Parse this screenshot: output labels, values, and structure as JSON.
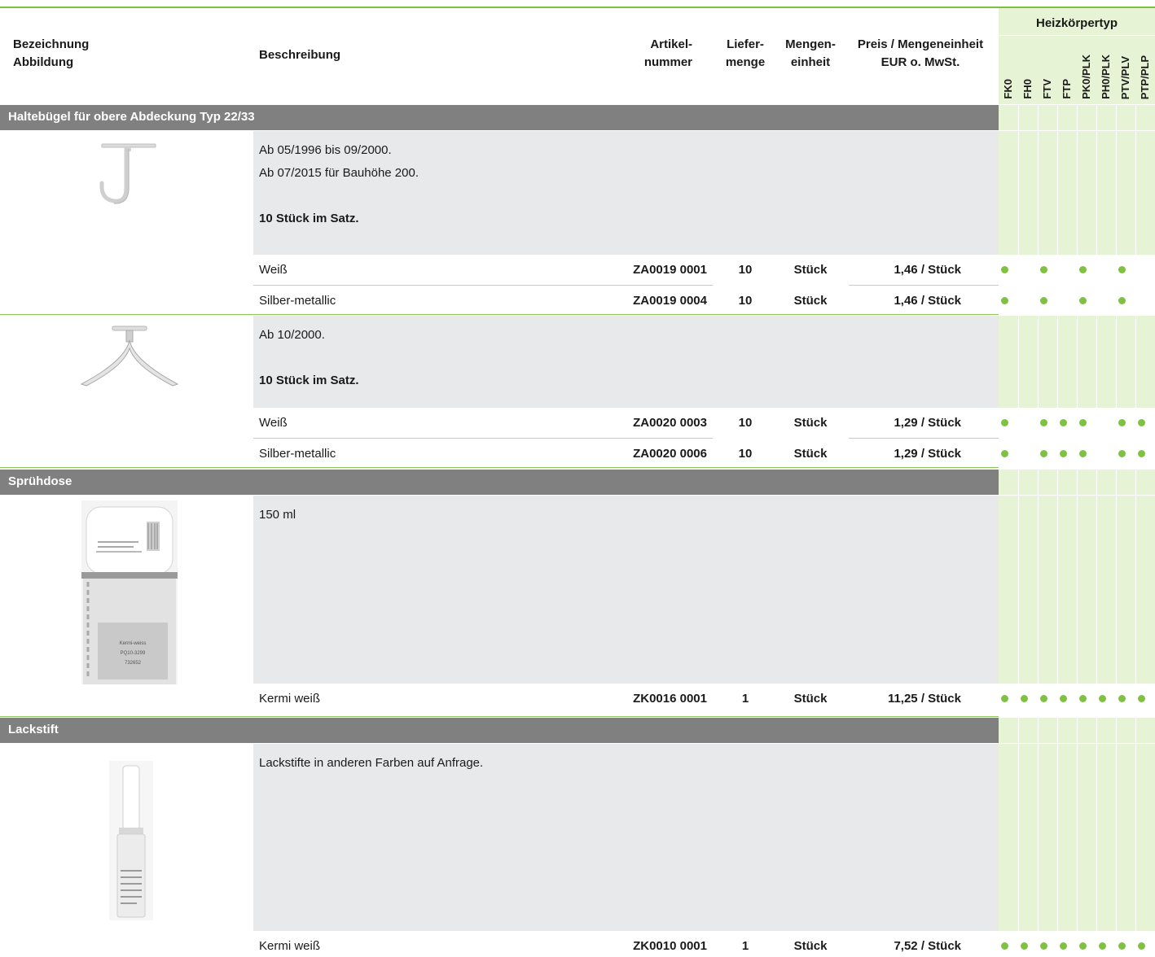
{
  "header": {
    "col1": [
      "Bezeichnung",
      "Abbildung"
    ],
    "col2": "Beschreibung",
    "col3": [
      "Artikel-",
      "nummer"
    ],
    "col4": [
      "Liefer-",
      "menge"
    ],
    "col5": [
      "Mengen-",
      "einheit"
    ],
    "col6": [
      "Preis / Mengeneinheit",
      "EUR o. MwSt."
    ],
    "heiz_title": "Heizkörpertyp",
    "heiz_types": [
      "FK0",
      "FH0",
      "FTV",
      "FTP",
      "PK0/PLK",
      "PH0/PLK",
      "PTV/PLV",
      "PTP/PLP"
    ]
  },
  "sections": [
    {
      "title": "Haltebügel für obere Abdeckung Typ 22/33",
      "groups": [
        {
          "image": "j-hook-bracket",
          "desc_lines": [
            "Ab 05/1996 bis 09/2000.",
            "Ab 07/2015 für Bauhöhe 200."
          ],
          "desc_bold": "10 Stück im Satz.",
          "rows": [
            {
              "label": "Weiß",
              "artikel": "ZA0019 0001",
              "menge": "10",
              "einheit": "Stück",
              "preis": "1,46 / Stück",
              "types": [
                1,
                0,
                1,
                0,
                1,
                0,
                1,
                0
              ]
            },
            {
              "label": "Silber-metallic",
              "artikel": "ZA0019 0004",
              "menge": "10",
              "einheit": "Stück",
              "preis": "1,46 / Stück",
              "types": [
                1,
                0,
                1,
                0,
                1,
                0,
                1,
                0
              ]
            }
          ]
        },
        {
          "image": "y-bracket",
          "desc_lines": [
            "Ab 10/2000."
          ],
          "desc_bold": "10 Stück im Satz.",
          "rows": [
            {
              "label": "Weiß",
              "artikel": "ZA0020 0003",
              "menge": "10",
              "einheit": "Stück",
              "preis": "1,29 / Stück",
              "types": [
                1,
                0,
                1,
                1,
                1,
                0,
                1,
                1
              ]
            },
            {
              "label": "Silber-metallic",
              "artikel": "ZA0020 0006",
              "menge": "10",
              "einheit": "Stück",
              "preis": "1,29 / Stück",
              "types": [
                1,
                0,
                1,
                1,
                1,
                0,
                1,
                1
              ]
            }
          ]
        }
      ]
    },
    {
      "title": "Sprühdose",
      "groups": [
        {
          "image": "spray-can",
          "can_label": [
            "Kermi-weiss",
            "PQ10-3299",
            "732652"
          ],
          "desc_lines": [
            "150 ml"
          ],
          "desc_bold": "",
          "rows": [
            {
              "label": "Kermi weiß",
              "artikel": "ZK0016 0001",
              "menge": "1",
              "einheit": "Stück",
              "preis": "11,25 / Stück",
              "types": [
                1,
                1,
                1,
                1,
                1,
                1,
                1,
                1
              ]
            }
          ]
        }
      ]
    },
    {
      "title": "Lackstift",
      "groups": [
        {
          "image": "paint-pen",
          "desc_lines": [
            "Lackstifte in anderen Farben auf Anfrage."
          ],
          "desc_bold": "",
          "rows": [
            {
              "label": "Kermi weiß",
              "artikel": "ZK0010 0001",
              "menge": "1",
              "einheit": "Stück",
              "preis": "7,52 / Stück",
              "types": [
                1,
                1,
                1,
                1,
                1,
                1,
                1,
                1
              ]
            }
          ]
        }
      ]
    }
  ]
}
